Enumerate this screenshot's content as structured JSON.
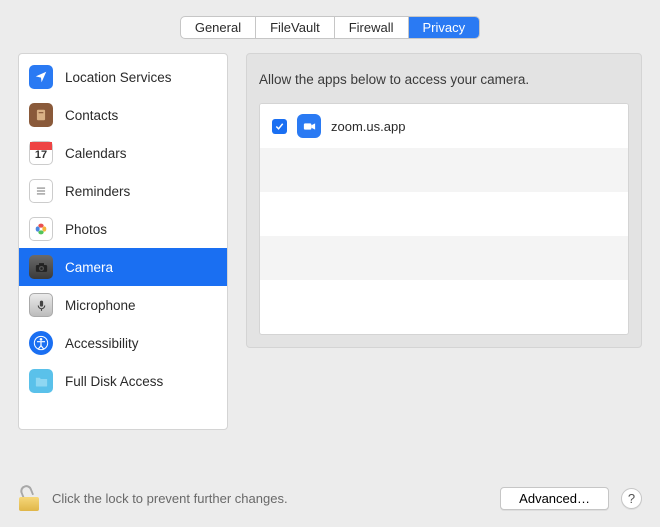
{
  "tabs": {
    "items": [
      {
        "label": "General"
      },
      {
        "label": "FileVault"
      },
      {
        "label": "Firewall"
      },
      {
        "label": "Privacy"
      }
    ],
    "active_index": 3
  },
  "sidebar": {
    "items": [
      {
        "label": "Location Services",
        "icon": "location-arrow-icon"
      },
      {
        "label": "Contacts",
        "icon": "contacts-icon"
      },
      {
        "label": "Calendars",
        "icon": "calendar-icon",
        "day": "17"
      },
      {
        "label": "Reminders",
        "icon": "reminders-icon"
      },
      {
        "label": "Photos",
        "icon": "photos-icon"
      },
      {
        "label": "Camera",
        "icon": "camera-icon"
      },
      {
        "label": "Microphone",
        "icon": "microphone-icon"
      },
      {
        "label": "Accessibility",
        "icon": "accessibility-icon"
      },
      {
        "label": "Full Disk Access",
        "icon": "folder-icon"
      }
    ],
    "selected_index": 5
  },
  "main": {
    "header": "Allow the apps below to access your camera.",
    "apps": [
      {
        "label": "zoom.us.app",
        "checked": true,
        "icon": "video-icon"
      }
    ]
  },
  "footer": {
    "lock_text": "Click the lock to prevent further changes.",
    "advanced_label": "Advanced…",
    "help_label": "?"
  }
}
